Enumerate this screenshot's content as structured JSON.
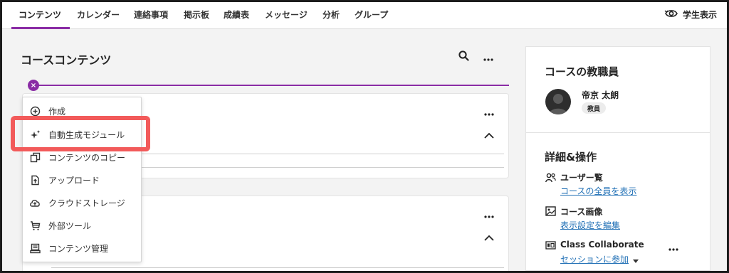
{
  "nav": {
    "tabs": [
      {
        "label": "コンテンツ"
      },
      {
        "label": "カレンダー"
      },
      {
        "label": "連絡事項"
      },
      {
        "label": "掲示板"
      },
      {
        "label": "成績表"
      },
      {
        "label": "メッセージ"
      },
      {
        "label": "分析"
      },
      {
        "label": "グループ"
      }
    ],
    "student_view_label": "学生表示"
  },
  "main": {
    "title": "コースコンテンツ",
    "divider_close": "×"
  },
  "menu": {
    "items": [
      {
        "label": "作成",
        "icon": "plus-circle-icon"
      },
      {
        "label": "自動生成モジュール",
        "icon": "sparkle-icon"
      },
      {
        "label": "コンテンツのコピー",
        "icon": "copy-icon"
      },
      {
        "label": "アップロード",
        "icon": "upload-icon"
      },
      {
        "label": "クラウドストレージ",
        "icon": "cloud-upload-icon"
      },
      {
        "label": "外部ツール",
        "icon": "cart-icon"
      },
      {
        "label": "コンテンツ管理",
        "icon": "content-manage-icon"
      }
    ]
  },
  "side": {
    "staff_title": "コースの教職員",
    "teacher_name": "帝京 太朗",
    "teacher_role": "教員",
    "details_title": "詳細&操作",
    "users_label": "ユーザー覧",
    "users_link": "コースの全員を表示",
    "image_label": "コース画像",
    "image_link": "表示設定を編集",
    "collab_label": "Class Collaborate",
    "collab_link": "セッションに参加"
  },
  "colors": {
    "accent": "#8a2ca5",
    "link": "#1f6fb5",
    "highlight": "#f25a5a"
  }
}
